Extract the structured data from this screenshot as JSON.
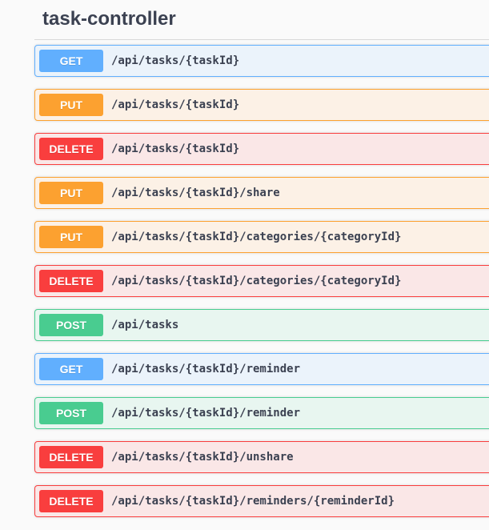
{
  "section": {
    "title": "task-controller"
  },
  "operations": [
    {
      "method": "GET",
      "path": "/api/tasks/{taskId}"
    },
    {
      "method": "PUT",
      "path": "/api/tasks/{taskId}"
    },
    {
      "method": "DELETE",
      "path": "/api/tasks/{taskId}"
    },
    {
      "method": "PUT",
      "path": "/api/tasks/{taskId}/share"
    },
    {
      "method": "PUT",
      "path": "/api/tasks/{taskId}/categories/{categoryId}"
    },
    {
      "method": "DELETE",
      "path": "/api/tasks/{taskId}/categories/{categoryId}"
    },
    {
      "method": "POST",
      "path": "/api/tasks"
    },
    {
      "method": "GET",
      "path": "/api/tasks/{taskId}/reminder"
    },
    {
      "method": "POST",
      "path": "/api/tasks/{taskId}/reminder"
    },
    {
      "method": "DELETE",
      "path": "/api/tasks/{taskId}/unshare"
    },
    {
      "method": "DELETE",
      "path": "/api/tasks/{taskId}/reminders/{reminderId}"
    }
  ],
  "colors": {
    "GET": "#61affe",
    "PUT": "#fca130",
    "DELETE": "#f93e3e",
    "POST": "#49cc90",
    "text": "#3b4151"
  }
}
